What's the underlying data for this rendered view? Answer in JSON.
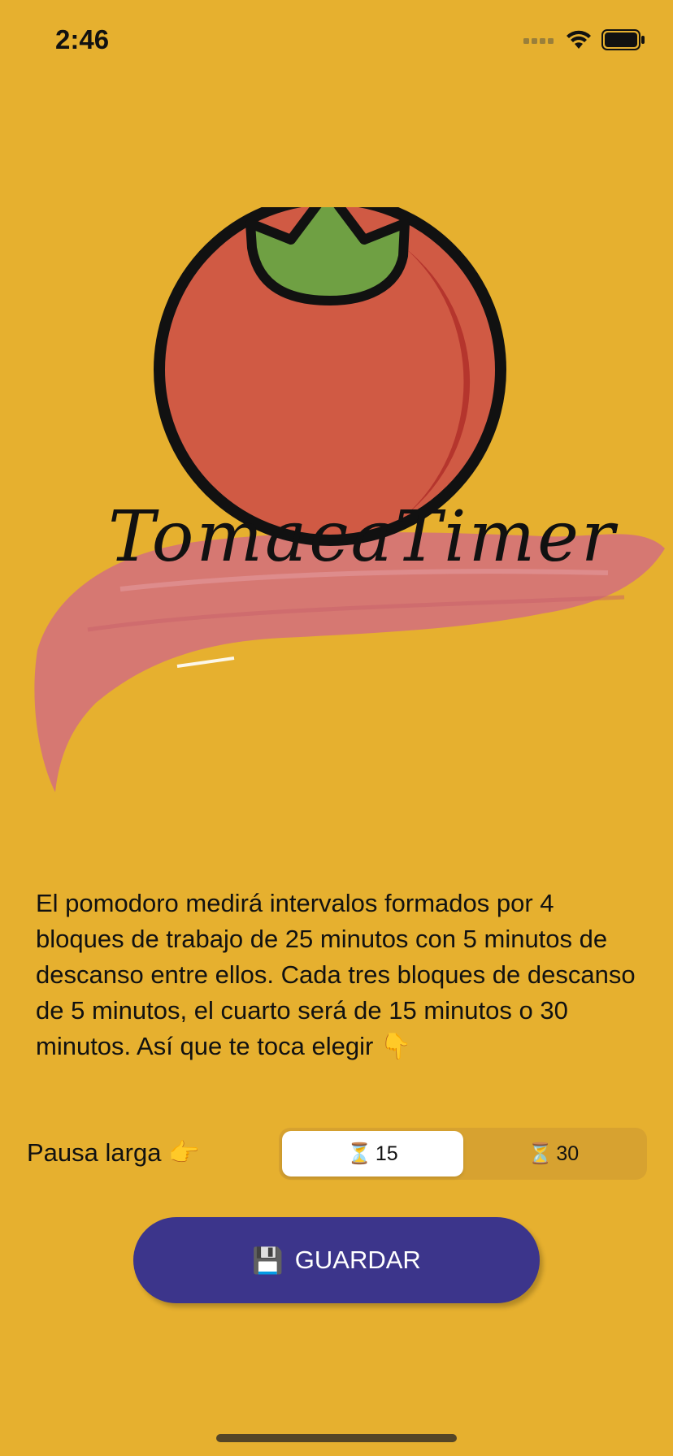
{
  "status_bar": {
    "time": "2:46",
    "icons": [
      "cellular-signal-icon",
      "wifi-icon",
      "battery-icon"
    ]
  },
  "logo": {
    "text": "TomacaTimer",
    "colors": {
      "tomato": "#D05A44",
      "tomato_shadow": "#B5352D",
      "leaf": "#6FA043",
      "stroke": "#111111",
      "brush": "#D4727A"
    }
  },
  "description": "El pomodoro medirá intervalos formados por 4 bloques de trabajo de 25 minutos con 5 minutos de descanso entre ellos. Cada tres bloques de descanso de 5 minutos, el cuarto será de 15 minutos o 30 minutos. Así que te toca elegir 👇",
  "long_break": {
    "label": "Pausa larga 👉",
    "options": [
      {
        "icon": "⏳",
        "value": "15",
        "selected": true
      },
      {
        "icon": "⏳",
        "value": "30",
        "selected": false
      }
    ]
  },
  "save_button": {
    "icon": "💾",
    "label": "GUARDAR"
  },
  "colors": {
    "background": "#E6B02F",
    "button": "#3C358B",
    "segment_track": "#D7A230"
  }
}
